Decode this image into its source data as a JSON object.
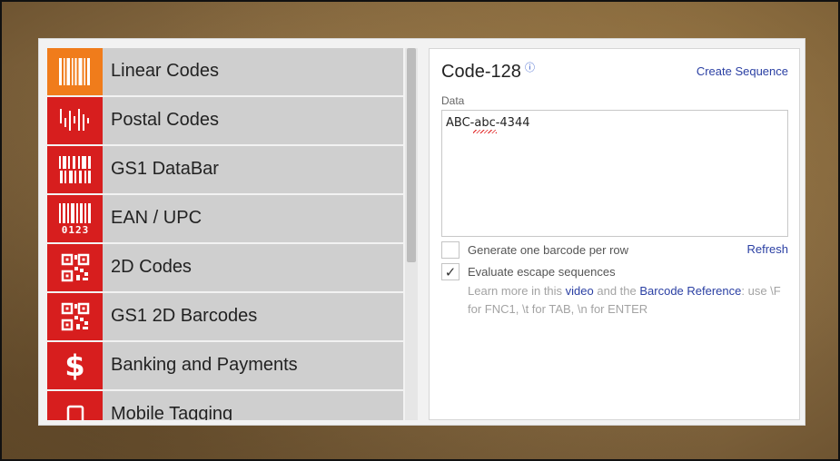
{
  "categories": [
    {
      "label": "Linear Codes",
      "icon": "linear-barcode-icon",
      "active": true
    },
    {
      "label": "Postal Codes",
      "icon": "postal-barcode-icon",
      "active": false
    },
    {
      "label": "GS1 DataBar",
      "icon": "gs1-databar-icon",
      "active": false
    },
    {
      "label": "EAN / UPC",
      "icon": "ean-upc-icon",
      "active": false
    },
    {
      "label": "2D Codes",
      "icon": "qr-code-icon",
      "active": false
    },
    {
      "label": "GS1 2D Barcodes",
      "icon": "qr-code-icon",
      "active": false
    },
    {
      "label": "Banking and Payments",
      "icon": "dollar-icon",
      "active": false
    },
    {
      "label": "Mobile Tagging",
      "icon": "mobile-phone-icon",
      "active": false
    }
  ],
  "ean_icon_digits": "0123",
  "dollar_glyph": "$",
  "panel": {
    "title": "Code-128",
    "info_glyph": "ⓘ",
    "create_sequence": "Create Sequence",
    "data_label": "Data",
    "data_value": "ABC-abc-4344",
    "refresh": "Refresh",
    "options": [
      {
        "label": "Generate one barcode per row",
        "checked": false,
        "mark": ""
      },
      {
        "label": "Evaluate escape sequences",
        "checked": true,
        "mark": "✓"
      }
    ],
    "help": {
      "pre": "Learn more in this ",
      "video_link": "video",
      "mid": " and the ",
      "reference_link": "Barcode Reference",
      "post": ": use \\F for FNC1, \\t for TAB, \\n for ENTER"
    }
  },
  "colors": {
    "active_icon": "#f07c1b",
    "icon_bg": "#d71e1e",
    "link": "#2a3fa3"
  }
}
